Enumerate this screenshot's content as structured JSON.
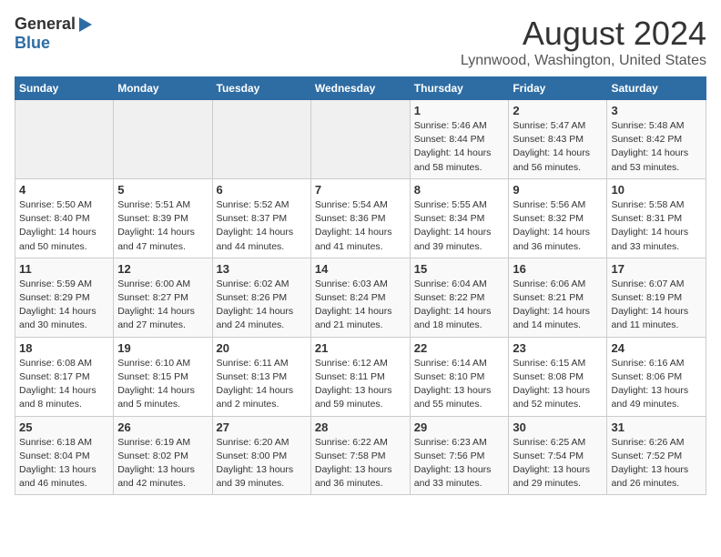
{
  "header": {
    "logo_general": "General",
    "logo_blue": "Blue",
    "month_year": "August 2024",
    "location": "Lynnwood, Washington, United States"
  },
  "calendar": {
    "weekdays": [
      "Sunday",
      "Monday",
      "Tuesday",
      "Wednesday",
      "Thursday",
      "Friday",
      "Saturday"
    ],
    "weeks": [
      [
        {
          "day": "",
          "detail": ""
        },
        {
          "day": "",
          "detail": ""
        },
        {
          "day": "",
          "detail": ""
        },
        {
          "day": "",
          "detail": ""
        },
        {
          "day": "1",
          "detail": "Sunrise: 5:46 AM\nSunset: 8:44 PM\nDaylight: 14 hours\nand 58 minutes."
        },
        {
          "day": "2",
          "detail": "Sunrise: 5:47 AM\nSunset: 8:43 PM\nDaylight: 14 hours\nand 56 minutes."
        },
        {
          "day": "3",
          "detail": "Sunrise: 5:48 AM\nSunset: 8:42 PM\nDaylight: 14 hours\nand 53 minutes."
        }
      ],
      [
        {
          "day": "4",
          "detail": "Sunrise: 5:50 AM\nSunset: 8:40 PM\nDaylight: 14 hours\nand 50 minutes."
        },
        {
          "day": "5",
          "detail": "Sunrise: 5:51 AM\nSunset: 8:39 PM\nDaylight: 14 hours\nand 47 minutes."
        },
        {
          "day": "6",
          "detail": "Sunrise: 5:52 AM\nSunset: 8:37 PM\nDaylight: 14 hours\nand 44 minutes."
        },
        {
          "day": "7",
          "detail": "Sunrise: 5:54 AM\nSunset: 8:36 PM\nDaylight: 14 hours\nand 41 minutes."
        },
        {
          "day": "8",
          "detail": "Sunrise: 5:55 AM\nSunset: 8:34 PM\nDaylight: 14 hours\nand 39 minutes."
        },
        {
          "day": "9",
          "detail": "Sunrise: 5:56 AM\nSunset: 8:32 PM\nDaylight: 14 hours\nand 36 minutes."
        },
        {
          "day": "10",
          "detail": "Sunrise: 5:58 AM\nSunset: 8:31 PM\nDaylight: 14 hours\nand 33 minutes."
        }
      ],
      [
        {
          "day": "11",
          "detail": "Sunrise: 5:59 AM\nSunset: 8:29 PM\nDaylight: 14 hours\nand 30 minutes."
        },
        {
          "day": "12",
          "detail": "Sunrise: 6:00 AM\nSunset: 8:27 PM\nDaylight: 14 hours\nand 27 minutes."
        },
        {
          "day": "13",
          "detail": "Sunrise: 6:02 AM\nSunset: 8:26 PM\nDaylight: 14 hours\nand 24 minutes."
        },
        {
          "day": "14",
          "detail": "Sunrise: 6:03 AM\nSunset: 8:24 PM\nDaylight: 14 hours\nand 21 minutes."
        },
        {
          "day": "15",
          "detail": "Sunrise: 6:04 AM\nSunset: 8:22 PM\nDaylight: 14 hours\nand 18 minutes."
        },
        {
          "day": "16",
          "detail": "Sunrise: 6:06 AM\nSunset: 8:21 PM\nDaylight: 14 hours\nand 14 minutes."
        },
        {
          "day": "17",
          "detail": "Sunrise: 6:07 AM\nSunset: 8:19 PM\nDaylight: 14 hours\nand 11 minutes."
        }
      ],
      [
        {
          "day": "18",
          "detail": "Sunrise: 6:08 AM\nSunset: 8:17 PM\nDaylight: 14 hours\nand 8 minutes."
        },
        {
          "day": "19",
          "detail": "Sunrise: 6:10 AM\nSunset: 8:15 PM\nDaylight: 14 hours\nand 5 minutes."
        },
        {
          "day": "20",
          "detail": "Sunrise: 6:11 AM\nSunset: 8:13 PM\nDaylight: 14 hours\nand 2 minutes."
        },
        {
          "day": "21",
          "detail": "Sunrise: 6:12 AM\nSunset: 8:11 PM\nDaylight: 13 hours\nand 59 minutes."
        },
        {
          "day": "22",
          "detail": "Sunrise: 6:14 AM\nSunset: 8:10 PM\nDaylight: 13 hours\nand 55 minutes."
        },
        {
          "day": "23",
          "detail": "Sunrise: 6:15 AM\nSunset: 8:08 PM\nDaylight: 13 hours\nand 52 minutes."
        },
        {
          "day": "24",
          "detail": "Sunrise: 6:16 AM\nSunset: 8:06 PM\nDaylight: 13 hours\nand 49 minutes."
        }
      ],
      [
        {
          "day": "25",
          "detail": "Sunrise: 6:18 AM\nSunset: 8:04 PM\nDaylight: 13 hours\nand 46 minutes."
        },
        {
          "day": "26",
          "detail": "Sunrise: 6:19 AM\nSunset: 8:02 PM\nDaylight: 13 hours\nand 42 minutes."
        },
        {
          "day": "27",
          "detail": "Sunrise: 6:20 AM\nSunset: 8:00 PM\nDaylight: 13 hours\nand 39 minutes."
        },
        {
          "day": "28",
          "detail": "Sunrise: 6:22 AM\nSunset: 7:58 PM\nDaylight: 13 hours\nand 36 minutes."
        },
        {
          "day": "29",
          "detail": "Sunrise: 6:23 AM\nSunset: 7:56 PM\nDaylight: 13 hours\nand 33 minutes."
        },
        {
          "day": "30",
          "detail": "Sunrise: 6:25 AM\nSunset: 7:54 PM\nDaylight: 13 hours\nand 29 minutes."
        },
        {
          "day": "31",
          "detail": "Sunrise: 6:26 AM\nSunset: 7:52 PM\nDaylight: 13 hours\nand 26 minutes."
        }
      ]
    ]
  }
}
